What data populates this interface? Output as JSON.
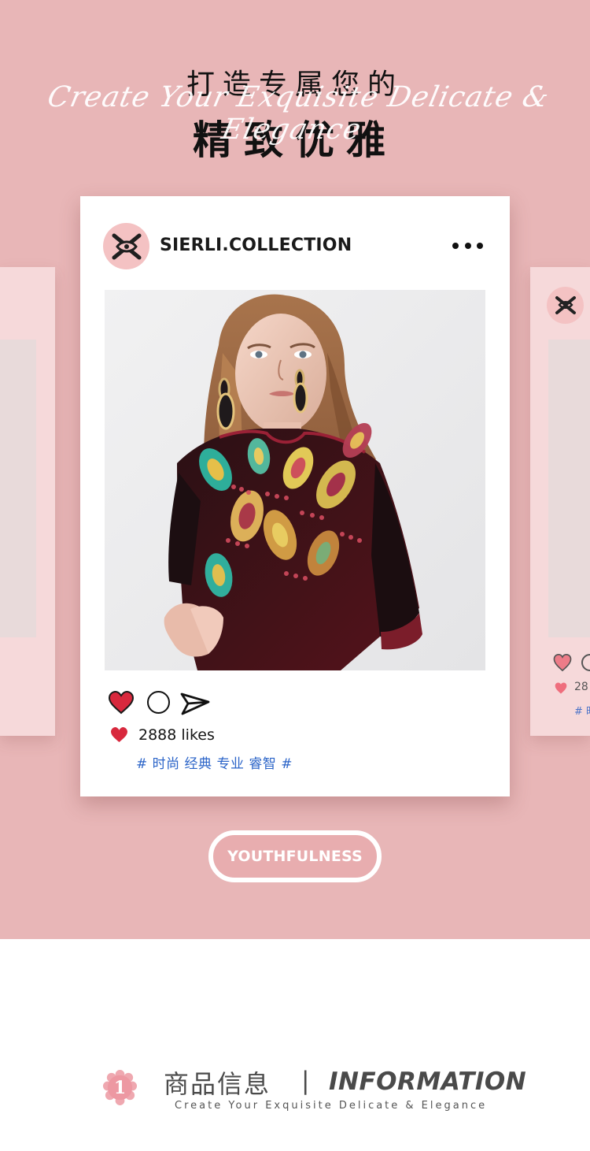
{
  "hero": {
    "title_line1": "打造专属您的",
    "script_text": "Create Your Exquisite Delicate & Elegance",
    "title_line2": "精致优雅"
  },
  "post": {
    "account_name": "SIERLI.COLLECTION",
    "likes_text": "2888 likes",
    "hashtags": "# 时尚 经典 专业 睿智 #",
    "logo_text": "XX"
  },
  "side_card_right": {
    "likes_text": "28",
    "hashtag_text": "# 时"
  },
  "button": {
    "label": "YOUTHFULNESS"
  },
  "section": {
    "number": "1",
    "title_cn": "商品信息",
    "divider": "|",
    "title_en": "INFORMATION",
    "subtitle": "Create Your Exquisite Delicate & Elegance"
  },
  "colors": {
    "hero_background": "#e8b6b7",
    "heart": "#d8283d",
    "hashtag_blue": "#2b64c8",
    "avatar_pink": "#f4c2c3"
  },
  "icons": {
    "more": "more-horizontal-icon",
    "like": "heart-icon",
    "comment": "comment-circle-icon",
    "share": "paper-plane-icon",
    "section_badge": "flower-badge-icon"
  }
}
